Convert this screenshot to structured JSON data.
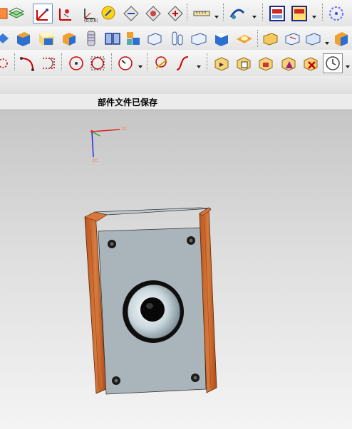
{
  "status": {
    "message": "部件文件已保存"
  },
  "viewport": {
    "triad": {
      "x_label": "XC",
      "z_label": "ZC"
    },
    "colors": {
      "cabinet_front": "#a9b5bb",
      "wood": "#c8662c",
      "speaker_cone": "#dfe9ee",
      "background_top": "#c6c6c6"
    }
  },
  "toolbars": {
    "row1": [
      "layer-icon",
      "wcs-display-icon",
      "wcs-dynamic-icon",
      "wcs-origin-icon",
      "wcs-rotate-icon",
      "wcs-orient-icon",
      "wcs-save-icon",
      "wcs-csys-icon",
      "measure-distance-icon",
      "analysis-icon",
      "view-layout-icon",
      "view-section-icon",
      "snap-point-icon"
    ],
    "row2": [
      "extrude-icon",
      "block-icon",
      "cylinder-icon",
      "box-icon",
      "thread-icon",
      "book-icon",
      "sheet-icon",
      "cylinder-solid-icon",
      "cube-icon",
      "edge-blend-icon",
      "rotate-face-icon",
      "offset-icon",
      "solid-icon"
    ],
    "row3": [
      "point-icon",
      "arc-icon",
      "line-icon",
      "circle-icon",
      "circle-fit-icon",
      "gauge-icon",
      "spline-curve-icon",
      "s-curve-icon",
      "feature-play-icon",
      "feature-move-icon",
      "feature-replace-icon",
      "feature-edit-icon",
      "feature-delete-icon",
      "clock-icon"
    ]
  }
}
